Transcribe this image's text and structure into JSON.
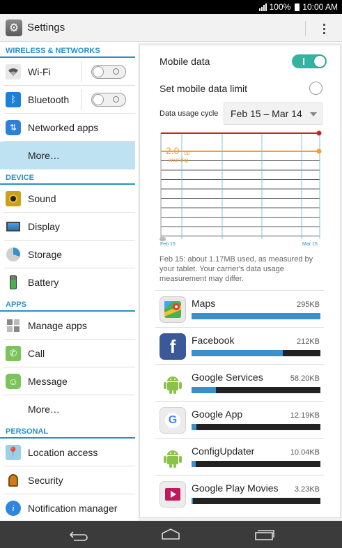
{
  "status_bar": {
    "battery_percent": "100%",
    "time": "10:00 AM"
  },
  "action_bar": {
    "title": "Settings",
    "settings_icon": "gear-icon",
    "menu_icon": "overflow-menu-icon"
  },
  "sidebar": {
    "sections": [
      {
        "header": "WIRELESS & NETWORKS",
        "items": [
          {
            "label": "Wi-Fi",
            "icon": "wifi-icon",
            "toggle": "off"
          },
          {
            "label": "Bluetooth",
            "icon": "bluetooth-icon",
            "toggle": "off"
          },
          {
            "label": "Networked apps",
            "icon": "networked-apps-icon"
          },
          {
            "label": "More…",
            "selected": true
          }
        ]
      },
      {
        "header": "DEVICE",
        "items": [
          {
            "label": "Sound",
            "icon": "speaker-icon"
          },
          {
            "label": "Display",
            "icon": "monitor-icon"
          },
          {
            "label": "Storage",
            "icon": "pie-chart-icon"
          },
          {
            "label": "Battery",
            "icon": "battery-icon"
          }
        ]
      },
      {
        "header": "APPS",
        "items": [
          {
            "label": "Manage apps",
            "icon": "grid-icon"
          },
          {
            "label": "Call",
            "icon": "phone-icon"
          },
          {
            "label": "Message",
            "icon": "message-icon"
          },
          {
            "label": "More…"
          }
        ]
      },
      {
        "header": "PERSONAL",
        "items": [
          {
            "label": "Location access",
            "icon": "map-pin-icon"
          },
          {
            "label": "Security",
            "icon": "lock-icon"
          },
          {
            "label": "Notification manager",
            "icon": "info-icon"
          }
        ]
      }
    ]
  },
  "data_usage": {
    "mobile_data_label": "Mobile data",
    "mobile_data_state": "on",
    "set_limit_label": "Set mobile data limit",
    "set_limit_checked": false,
    "cycle_label": "Data usage cycle",
    "cycle_value": "Feb 15 – Mar 14",
    "warning_value": "2.0",
    "warning_unit": "GB",
    "warning_label": "warning",
    "x_start_label": "Feb 15",
    "x_end_label": "Mar 15",
    "note": "Feb 15: about 1.17MB used, as measured by your tablet. Your carrier's data usage measurement may differ.",
    "colors": {
      "limit": "#c62828",
      "warning": "#f0a030",
      "grid": "#222222",
      "vertical_grid": "#5fb8e0",
      "app_bar": "#3a8fcc",
      "toggle_on": "#35b3a1",
      "accent": "#2a8fc8"
    }
  },
  "apps": [
    {
      "name": "Maps",
      "size": "295KB",
      "icon": "maps-icon",
      "usage_fraction": 1.0
    },
    {
      "name": "Facebook",
      "size": "212KB",
      "icon": "facebook-icon",
      "usage_fraction": 0.71
    },
    {
      "name": "Google Services",
      "size": "58.20KB",
      "icon": "android-icon",
      "usage_fraction": 0.19
    },
    {
      "name": "Google App",
      "size": "12.19KB",
      "icon": "google-icon",
      "usage_fraction": 0.04
    },
    {
      "name": "ConfigUpdater",
      "size": "10.04KB",
      "icon": "android-icon",
      "usage_fraction": 0.035
    },
    {
      "name": "Google Play Movies",
      "size": "3.23KB",
      "icon": "play-movies-icon",
      "usage_fraction": 0.012
    }
  ],
  "nav_bar": {
    "back_icon": "back-icon",
    "home_icon": "home-icon",
    "recents_icon": "recent-apps-icon"
  }
}
